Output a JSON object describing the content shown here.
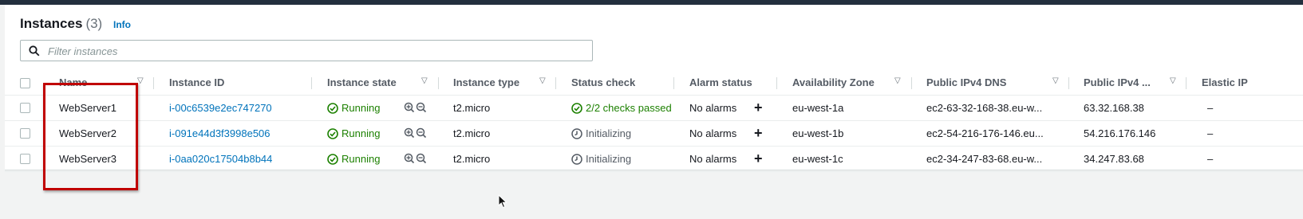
{
  "header": {
    "title": "Instances",
    "count": "(3)",
    "info_link": "Info"
  },
  "filter": {
    "placeholder": "Filter instances",
    "value": ""
  },
  "columns": [
    "Name",
    "Instance ID",
    "Instance state",
    "Instance type",
    "Status check",
    "Alarm status",
    "Availability Zone",
    "Public IPv4 DNS",
    "Public IPv4 ...",
    "Elastic IP"
  ],
  "rows": [
    {
      "name": "WebServer1",
      "instance_id": "i-00c6539e2ec747270",
      "state": "Running",
      "type": "t2.micro",
      "status_check": "2/2 checks passed",
      "status_kind": "passed",
      "alarm": "No alarms",
      "zone": "eu-west-1a",
      "dns": "ec2-63-32-168-38.eu-w...",
      "ipv4": "63.32.168.38",
      "elastic_ip": "–"
    },
    {
      "name": "WebServer2",
      "instance_id": "i-091e44d3f3998e506",
      "state": "Running",
      "type": "t2.micro",
      "status_check": "Initializing",
      "status_kind": "initializing",
      "alarm": "No alarms",
      "zone": "eu-west-1b",
      "dns": "ec2-54-216-176-146.eu...",
      "ipv4": "54.216.176.146",
      "elastic_ip": "–"
    },
    {
      "name": "WebServer3",
      "instance_id": "i-0aa020c17504b8b44",
      "state": "Running",
      "type": "t2.micro",
      "status_check": "Initializing",
      "status_kind": "initializing",
      "alarm": "No alarms",
      "zone": "eu-west-1c",
      "dns": "ec2-34-247-83-68.eu-w...",
      "ipv4": "34.247.83.68",
      "elastic_ip": "–"
    }
  ],
  "colors": {
    "link": "#0073bb",
    "success": "#1d8102",
    "highlight_box": "#c00000",
    "top_bar": "#232f3e"
  },
  "icons": {
    "filter": "search-icon",
    "state": "check-circle-icon",
    "status_passed": "check-circle-icon",
    "status_initializing": "clock-icon",
    "zoom": "zoom-in-out-icon",
    "alarm_add": "plus-icon",
    "sort": "caret-down-icon"
  }
}
